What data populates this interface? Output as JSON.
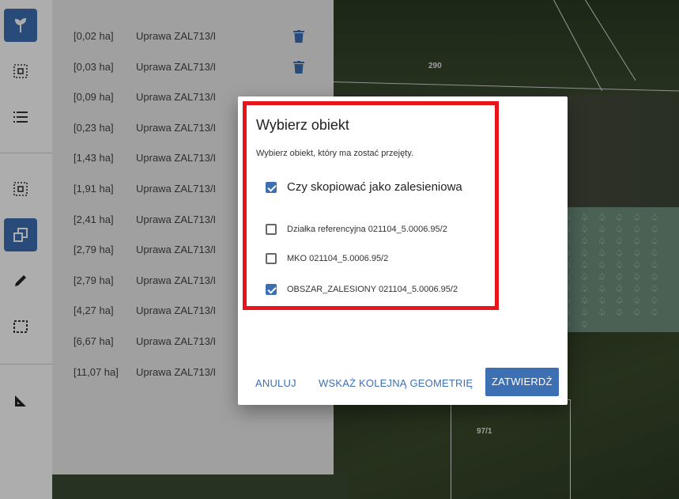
{
  "map": {
    "parcel_labels": [
      "290",
      "97/1"
    ],
    "forest_pattern": "♤ ♤ ♤ ♤ ♤ ♤ ♤ ♤ ♤ ♤ ♤ ♤ ♤ ♤ ♤ ♤ ♤ ♤ ♤ ♤ ♤ ♤ ♤ ♤ ♤ ♤ ♤ ♤ ♤ ♤ ♤ ♤ ♤ ♤ ♤ ♤ ♤ ♤ ♤ ♤ ♤ ♤ ♤ ♤ ♤ ♤ ♤ ♤ ♤ ♤ ♤ ♤ ♤ ♤ ♤ ♤"
  },
  "toolbar": {
    "tools": [
      {
        "icon": "plant-icon",
        "active": true
      },
      {
        "icon": "select-area-icon",
        "active": false
      },
      {
        "icon": "list-icon",
        "active": false
      },
      {
        "icon": "select-area-icon",
        "active": false
      },
      {
        "icon": "copy-geometry-icon",
        "active": true
      },
      {
        "icon": "pencil-icon",
        "active": false
      },
      {
        "icon": "dashed-rectangle-icon",
        "active": false
      },
      {
        "icon": "measure-icon",
        "active": false
      }
    ]
  },
  "list": {
    "rows": [
      {
        "area": "[0,02 ha]",
        "name": "Uprawa ZAL713/I",
        "trash": true
      },
      {
        "area": "[0,03 ha]",
        "name": "Uprawa ZAL713/I",
        "trash": true
      },
      {
        "area": "[0,09 ha]",
        "name": "Uprawa ZAL713/I",
        "trash": false
      },
      {
        "area": "[0,23 ha]",
        "name": "Uprawa ZAL713/I",
        "trash": false
      },
      {
        "area": "[1,43 ha]",
        "name": "Uprawa ZAL713/I",
        "trash": false
      },
      {
        "area": "[1,91 ha]",
        "name": "Uprawa ZAL713/I",
        "trash": false
      },
      {
        "area": "[2,41 ha]",
        "name": "Uprawa ZAL713/I",
        "trash": false
      },
      {
        "area": "[2,79 ha]",
        "name": "Uprawa ZAL713/I",
        "trash": false
      },
      {
        "area": "[2,79 ha]",
        "name": "Uprawa ZAL713/I",
        "trash": false
      },
      {
        "area": "[4,27 ha]",
        "name": "Uprawa ZAL713/I",
        "trash": false
      },
      {
        "area": "[6,67 ha]",
        "name": "Uprawa ZAL713/I",
        "trash": false
      },
      {
        "area": "[11,07 ha]",
        "name": "Uprawa ZAL713/I",
        "trash": true
      }
    ]
  },
  "dialog": {
    "title": "Wybierz obiekt",
    "subtitle": "Wybierz obiekt, który ma zostać przejęty.",
    "copy_option": {
      "label": "Czy skopiować jako zalesieniowa",
      "checked": true
    },
    "options": [
      {
        "label": "Działka referencyjna 021104_5.0006.95/2",
        "checked": false
      },
      {
        "label": "MKO 021104_5.0006.95/2",
        "checked": false
      },
      {
        "label": "OBSZAR_ZALESIONY 021104_5.0006.95/2",
        "checked": true
      }
    ],
    "buttons": {
      "cancel": "ANULUJ",
      "next_geometry": "WSKAŻ KOLEJNĄ GEOMETRIĘ",
      "confirm": "ZATWIERDŹ"
    }
  },
  "colors": {
    "accent": "#3d6fb3",
    "highlight": "#e8141a"
  }
}
